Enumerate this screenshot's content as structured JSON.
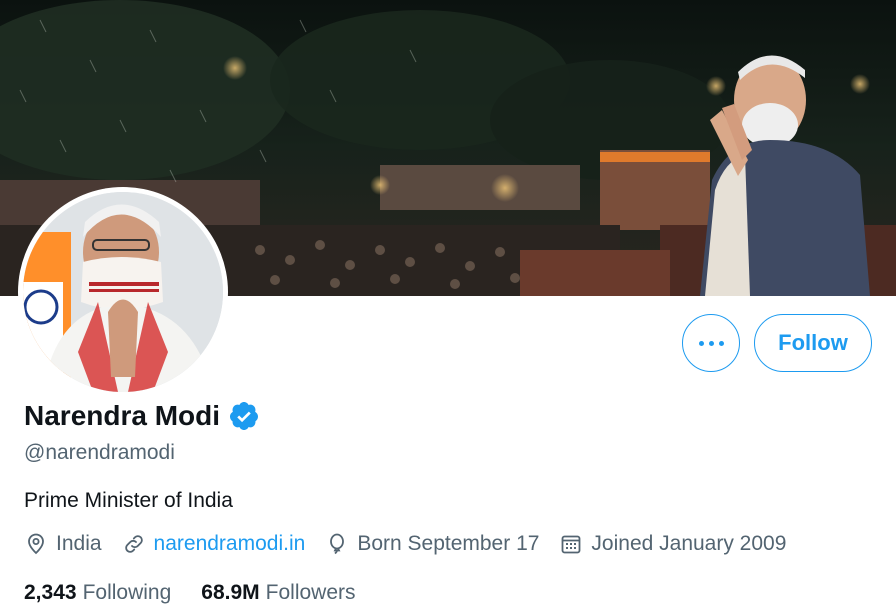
{
  "profile": {
    "name": "Narendra Modi",
    "handle": "@narendramodi",
    "bio": "Prime Minister of India",
    "location": "India",
    "website": "narendramodi.in",
    "birthday": "Born September 17",
    "joined": "Joined January 2009",
    "following_count": "2,343",
    "following_label": "Following",
    "followers_count": "68.9M",
    "followers_label": "Followers"
  },
  "actions": {
    "follow_label": "Follow"
  },
  "icons": {
    "more": "more-horizontal-icon",
    "verified": "verified-badge-icon",
    "location": "location-pin-icon",
    "link": "link-icon",
    "birthday": "balloon-icon",
    "joined": "calendar-icon"
  },
  "colors": {
    "accent": "#1d9bf0",
    "text_primary": "#0f1419",
    "text_secondary": "#536471"
  }
}
